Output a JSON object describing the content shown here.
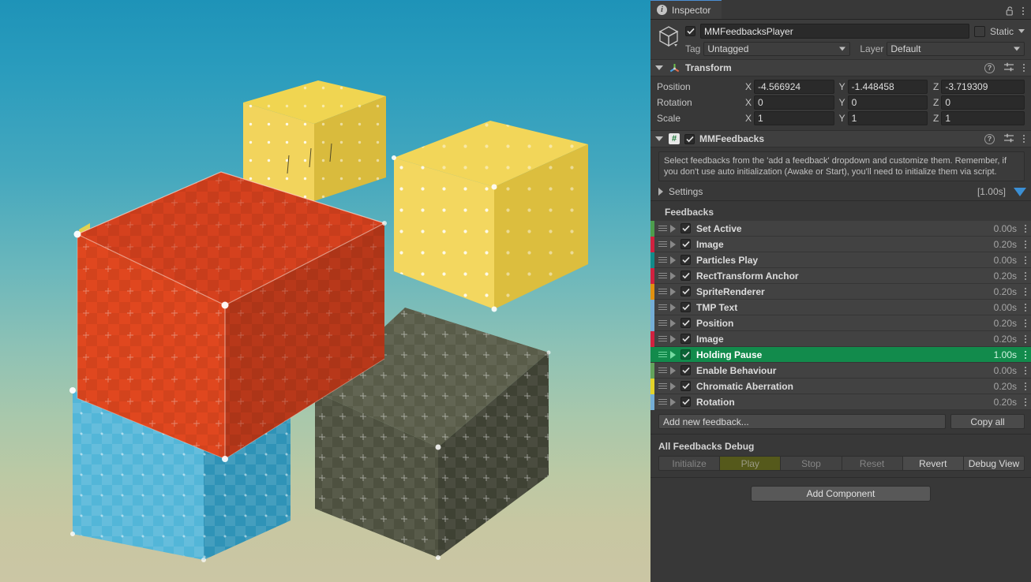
{
  "viewport": {
    "name": "scene-viewport",
    "background_top": "#1e93b8",
    "background_bottom": "#cbc6a4",
    "cubes": [
      {
        "name": "yellow-cube-back",
        "top_color": "#f0d551",
        "left_color": "#f2d45c",
        "right_color": "#d9bb3d"
      },
      {
        "name": "yellow-cube-right",
        "top_color": "#f2d659",
        "left_color": "#f3d75f",
        "right_color": "#dcbe3e"
      },
      {
        "name": "red-cube",
        "top_color": "#d5411e",
        "left_color": "#e0471f",
        "right_color": "#b8381a"
      },
      {
        "name": "blue-cube",
        "top_color": "#49b0d4",
        "left_color": "#53b6d8",
        "right_color": "#2f93b7"
      },
      {
        "name": "dark-cube",
        "top_color": "#595c49",
        "left_color": "#4e5140",
        "right_color": "#3f4234"
      }
    ]
  },
  "inspector": {
    "tab_label": "Inspector",
    "tab_icon": "info-icon",
    "lock_icon": "lock-open-icon",
    "menu_icon": "kebab-menu-icon",
    "object": {
      "icon": "cube-icon",
      "enabled": true,
      "name": "MMFeedbacksPlayer",
      "static_label": "Static",
      "tag_label": "Tag",
      "tag_value": "Untagged",
      "layer_label": "Layer",
      "layer_value": "Default"
    },
    "transform": {
      "title": "Transform",
      "icon": "transform-axes-icon",
      "help_icon": "help-icon",
      "presets_icon": "presets-icon",
      "menu_icon": "kebab-menu-icon",
      "rows": [
        {
          "label": "Position",
          "x": "-4.566924",
          "y": "-1.448458",
          "z": "-3.719309"
        },
        {
          "label": "Rotation",
          "x": "0",
          "y": "0",
          "z": "0"
        },
        {
          "label": "Scale",
          "x": "1",
          "y": "1",
          "z": "1"
        }
      ],
      "axis_labels": [
        "X",
        "Y",
        "Z"
      ]
    },
    "mmfeedbacks": {
      "title": "MMFeedbacks",
      "script_icon": "csharp-script-icon",
      "enabled": true,
      "help_icon": "help-icon",
      "presets_icon": "presets-icon",
      "menu_icon": "kebab-menu-icon",
      "helpbox": "Select feedbacks from the 'add a feedback' dropdown and customize them. Remember, if you don't use auto initialization (Awake or Start), you'll need to initialize them via script.",
      "settings_label": "Settings",
      "settings_duration": "[1.00s]",
      "settings_play_icon": "play-triangle-icon",
      "feedbacks_title": "Feedbacks",
      "feedbacks": [
        {
          "name": "Set Active",
          "duration": "0.00s",
          "color": "#4d9e4d",
          "enabled": true,
          "selected": false
        },
        {
          "name": "Image",
          "duration": "0.20s",
          "color": "#d1213f",
          "enabled": true,
          "selected": false
        },
        {
          "name": "Particles Play",
          "duration": "0.00s",
          "color": "#128b8b",
          "enabled": true,
          "selected": false
        },
        {
          "name": "RectTransform Anchor",
          "duration": "0.20s",
          "color": "#d1213f",
          "enabled": true,
          "selected": false
        },
        {
          "name": "SpriteRenderer",
          "duration": "0.20s",
          "color": "#e09010",
          "enabled": true,
          "selected": false
        },
        {
          "name": "TMP Text",
          "duration": "0.00s",
          "color": "#74aed6",
          "enabled": true,
          "selected": false
        },
        {
          "name": "Position",
          "duration": "0.20s",
          "color": "#74aed6",
          "enabled": true,
          "selected": false
        },
        {
          "name": "Image",
          "duration": "0.20s",
          "color": "#d1213f",
          "enabled": true,
          "selected": false
        },
        {
          "name": "Holding Pause",
          "duration": "1.00s",
          "color": "#128b4c",
          "enabled": true,
          "selected": true
        },
        {
          "name": "Enable Behaviour",
          "duration": "0.00s",
          "color": "#63a35c",
          "enabled": true,
          "selected": false
        },
        {
          "name": "Chromatic Aberration",
          "duration": "0.20s",
          "color": "#e3d32a",
          "enabled": true,
          "selected": false
        },
        {
          "name": "Rotation",
          "duration": "0.20s",
          "color": "#74aed6",
          "enabled": true,
          "selected": false
        }
      ],
      "add_feedback_placeholder": "Add new feedback...",
      "copy_all_label": "Copy all",
      "debug_title": "All Feedbacks Debug",
      "debug_buttons": [
        {
          "label": "Initialize",
          "state": "dim"
        },
        {
          "label": "Play",
          "state": "active"
        },
        {
          "label": "Stop",
          "state": "dim"
        },
        {
          "label": "Reset",
          "state": "dim"
        },
        {
          "label": "Revert",
          "state": "strong"
        },
        {
          "label": "Debug View",
          "state": "strong"
        }
      ]
    },
    "add_component_label": "Add Component",
    "accent_color": "#4a8fd4",
    "selected_row_color": "#128b4c"
  }
}
